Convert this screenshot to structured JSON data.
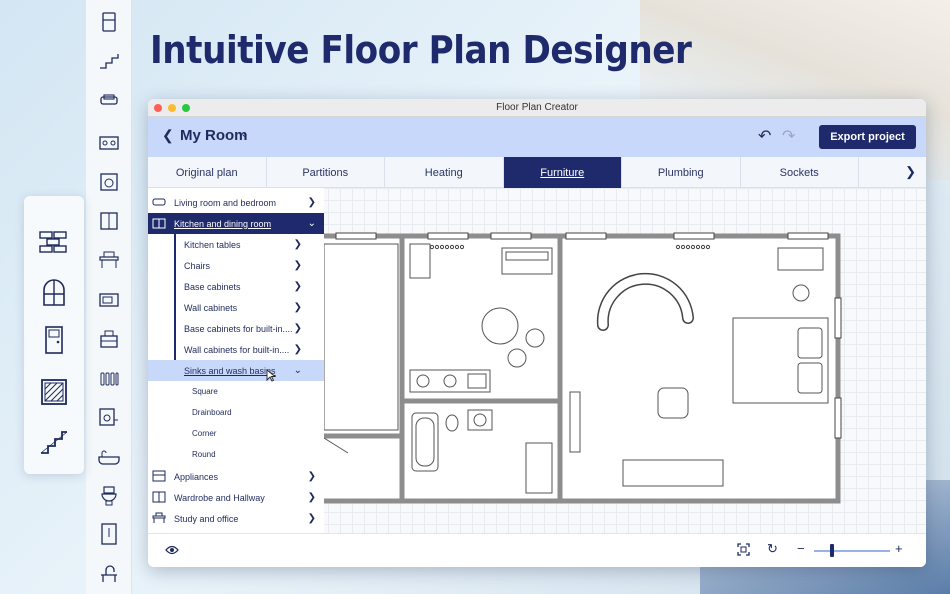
{
  "headline": "Intuitive Floor Plan Designer",
  "window": {
    "title": "Floor Plan Creator"
  },
  "toolbar": {
    "room_name": "My Room",
    "export_label": "Export project"
  },
  "tabs": [
    {
      "label": "Original plan",
      "active": false
    },
    {
      "label": "Partitions",
      "active": false
    },
    {
      "label": "Heating",
      "active": false
    },
    {
      "label": "Furniture",
      "active": true
    },
    {
      "label": "Plumbing",
      "active": false
    },
    {
      "label": "Sockets",
      "active": false
    }
  ],
  "menu": {
    "categories": {
      "living": "Living room and bedroom",
      "kitchen": "Kitchen and dining room",
      "appliances": "Appliances",
      "wardrobe": "Wardrobe and Hallway",
      "study": "Study and office"
    },
    "kitchen_items": {
      "tables": "Kitchen tables",
      "chairs": "Chairs",
      "base": "Base cabinets",
      "wall": "Wall cabinets",
      "base_built": "Base cabinets for built-in....",
      "wall_built": "Wall cabinets for built-in....",
      "sinks": "Sinks and wash basins"
    },
    "sink_items": {
      "square": "Square",
      "drainboard": "Drainboard",
      "corner": "Corner",
      "round": "Round"
    }
  },
  "colors": {
    "accent": "#1e2a6b",
    "toolbar": "#c8d8fb",
    "highlight": "#c8d8fb"
  }
}
